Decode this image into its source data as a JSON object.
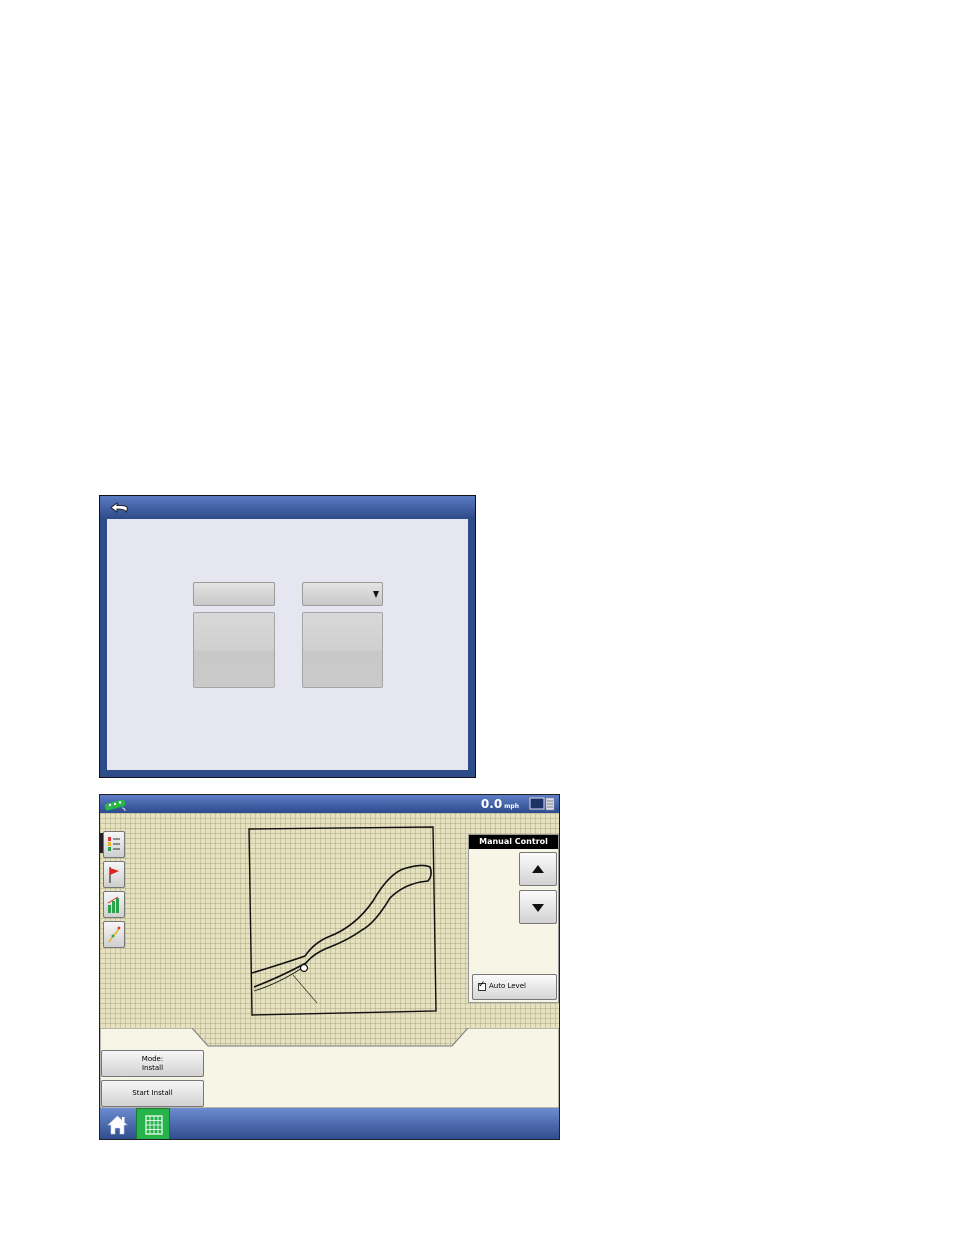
{
  "screen1": {
    "fields": [
      {
        "id": "left-field",
        "value": ""
      },
      {
        "id": "right-dropdown",
        "value": "",
        "has_dropdown": true
      }
    ],
    "icons": {
      "back": "back-arrow-icon"
    }
  },
  "screen2": {
    "status": {
      "speed": "0.0",
      "speed_unit": "mph"
    },
    "manual_control": {
      "title": "Manual Control",
      "auto_level": {
        "label": "Auto Level",
        "checked": true
      }
    },
    "mode_button": {
      "line1": "Mode:",
      "line2": "Install"
    },
    "start_button": {
      "label": "Start Install"
    },
    "left_toolbar": [
      "legend-icon",
      "flag-icon",
      "bar-chart-icon",
      "guidance-line-icon"
    ],
    "bottom_nav": [
      "home-icon",
      "map-grid-icon"
    ],
    "colors": {
      "title_bar": "#2f4c8a",
      "map_bg": "#e6e2c0",
      "active_nav": "#25b34a",
      "panel_bg": "#f7f6e6"
    }
  }
}
